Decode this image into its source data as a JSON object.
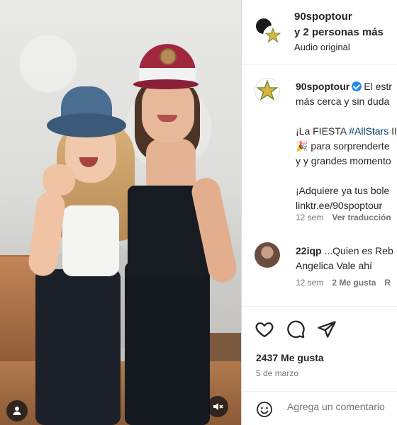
{
  "header": {
    "username": "90spoptour",
    "collaborators": "y 2 personas más",
    "audio": "Audio original"
  },
  "caption": {
    "username": "90spoptour",
    "line1": "El estr",
    "line2": "más cerca y sin duda",
    "line3_prefix": "¡La FIESTA ",
    "hashtag": "#AllStars",
    "line3_suffix": " II",
    "line4": "🎉 para sorprenderte",
    "line5": "y y grandes momento",
    "line6": "¡Adquiere ya tus bole",
    "line7": "linktr.ee/90spoptour",
    "time": "12 sem",
    "translate": "Ver traducción"
  },
  "comment": {
    "username": "22iqp",
    "text_line1": " ...Quien es Reb",
    "text_line2": "Angelica Vale ahí",
    "time": "12 sem",
    "likes": "2 Me gusta",
    "reply": "R"
  },
  "post": {
    "likes": "2437 Me gusta",
    "date": "5 de marzo"
  },
  "composer": {
    "placeholder": "Agrega un comentario"
  },
  "icons": {
    "user_tag": "user-icon",
    "mute": "muted-speaker-icon",
    "like": "heart-icon",
    "comment": "comment-icon",
    "share": "send-icon",
    "emoji": "smiley-icon",
    "verified": "verified-badge-icon"
  },
  "colors": {
    "link": "#00376b",
    "verified": "#1f8df0",
    "muted_text": "#737373"
  }
}
